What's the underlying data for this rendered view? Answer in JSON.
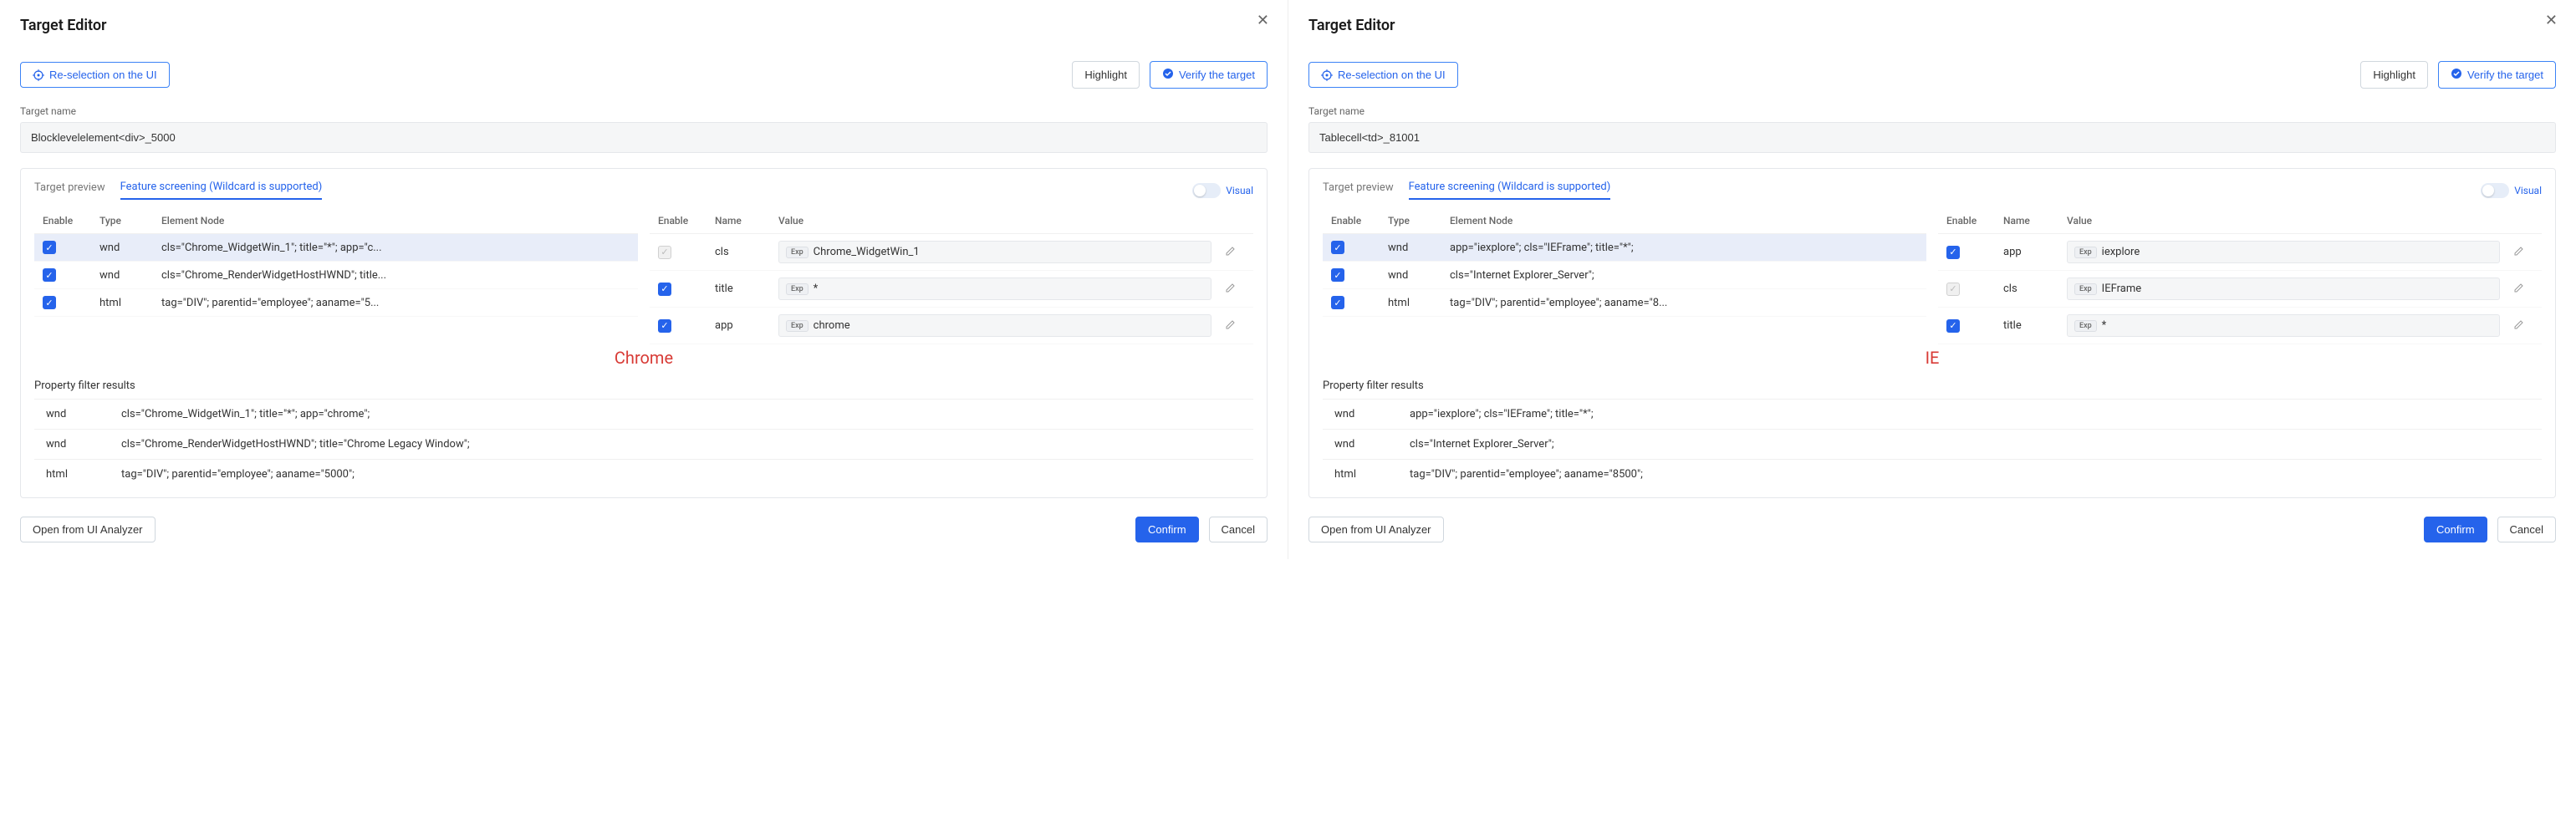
{
  "dialogs": [
    {
      "title": "Target Editor",
      "reselection_label": "Re-selection on the UI",
      "highlight_label": "Highlight",
      "verify_label": "Verify the target",
      "target_name_label": "Target name",
      "target_name_value": "Blocklevelelement<div>_5000",
      "tab_preview": "Target preview",
      "tab_feature": "Feature screening (Wildcard is supported)",
      "visual_label": "Visual",
      "left_headers": {
        "enable": "Enable",
        "type": "Type",
        "node": "Element Node"
      },
      "left_rows": [
        {
          "checked": true,
          "type": "wnd",
          "node": "cls=\"Chrome_WidgetWin_1\"; title=\"*\"; app=\"c...",
          "selected": true
        },
        {
          "checked": true,
          "type": "wnd",
          "node": "cls=\"Chrome_RenderWidgetHostHWND\"; title...",
          "selected": false
        },
        {
          "checked": true,
          "type": "html",
          "node": "tag=\"DIV\"; parentid=\"employee\"; aaname=\"5...",
          "selected": false
        }
      ],
      "right_headers": {
        "enable": "Enable",
        "name": "Name",
        "value": "Value"
      },
      "right_rows": [
        {
          "checked": false,
          "disabled": true,
          "name": "cls",
          "exp": true,
          "value": "Chrome_WidgetWin_1"
        },
        {
          "checked": true,
          "disabled": false,
          "name": "title",
          "exp": true,
          "value": "*"
        },
        {
          "checked": true,
          "disabled": false,
          "name": "app",
          "exp": true,
          "value": "chrome"
        }
      ],
      "browser_label": "Chrome",
      "filter_header": "Property filter results",
      "filter_rows": [
        {
          "key": "wnd",
          "val": "cls=\"Chrome_WidgetWin_1\"; title=\"*\"; app=\"chrome\";"
        },
        {
          "key": "wnd",
          "val": "cls=\"Chrome_RenderWidgetHostHWND\"; title=\"Chrome Legacy Window\";"
        },
        {
          "key": "html",
          "val": "tag=\"DIV\"; parentid=\"employee\"; aaname=\"5000\";"
        }
      ],
      "open_analyzer_label": "Open from UI Analyzer",
      "confirm_label": "Confirm",
      "cancel_label": "Cancel"
    },
    {
      "title": "Target Editor",
      "reselection_label": "Re-selection on the UI",
      "highlight_label": "Highlight",
      "verify_label": "Verify the target",
      "target_name_label": "Target name",
      "target_name_value": "Tablecell<td>_81001",
      "tab_preview": "Target preview",
      "tab_feature": "Feature screening (Wildcard is supported)",
      "visual_label": "Visual",
      "left_headers": {
        "enable": "Enable",
        "type": "Type",
        "node": "Element Node"
      },
      "left_rows": [
        {
          "checked": true,
          "type": "wnd",
          "node": "app=\"iexplore\"; cls=\"IEFrame\"; title=\"*\";",
          "selected": true
        },
        {
          "checked": true,
          "type": "wnd",
          "node": "cls=\"Internet Explorer_Server\";",
          "selected": false
        },
        {
          "checked": true,
          "type": "html",
          "node": "tag=\"DIV\"; parentid=\"employee\"; aaname=\"8...",
          "selected": false
        }
      ],
      "right_headers": {
        "enable": "Enable",
        "name": "Name",
        "value": "Value"
      },
      "right_rows": [
        {
          "checked": true,
          "disabled": false,
          "name": "app",
          "exp": true,
          "value": "iexplore"
        },
        {
          "checked": false,
          "disabled": true,
          "name": "cls",
          "exp": true,
          "value": "IEFrame"
        },
        {
          "checked": true,
          "disabled": false,
          "name": "title",
          "exp": true,
          "value": "*"
        }
      ],
      "browser_label": "IE",
      "filter_header": "Property filter results",
      "filter_rows": [
        {
          "key": "wnd",
          "val": "app=\"iexplore\"; cls=\"IEFrame\"; title=\"*\";"
        },
        {
          "key": "wnd",
          "val": "cls=\"Internet Explorer_Server\";"
        },
        {
          "key": "html",
          "val": "tag=\"DIV\"; parentid=\"employee\"; aaname=\"8500\";"
        }
      ],
      "open_analyzer_label": "Open from UI Analyzer",
      "confirm_label": "Confirm",
      "cancel_label": "Cancel"
    }
  ]
}
